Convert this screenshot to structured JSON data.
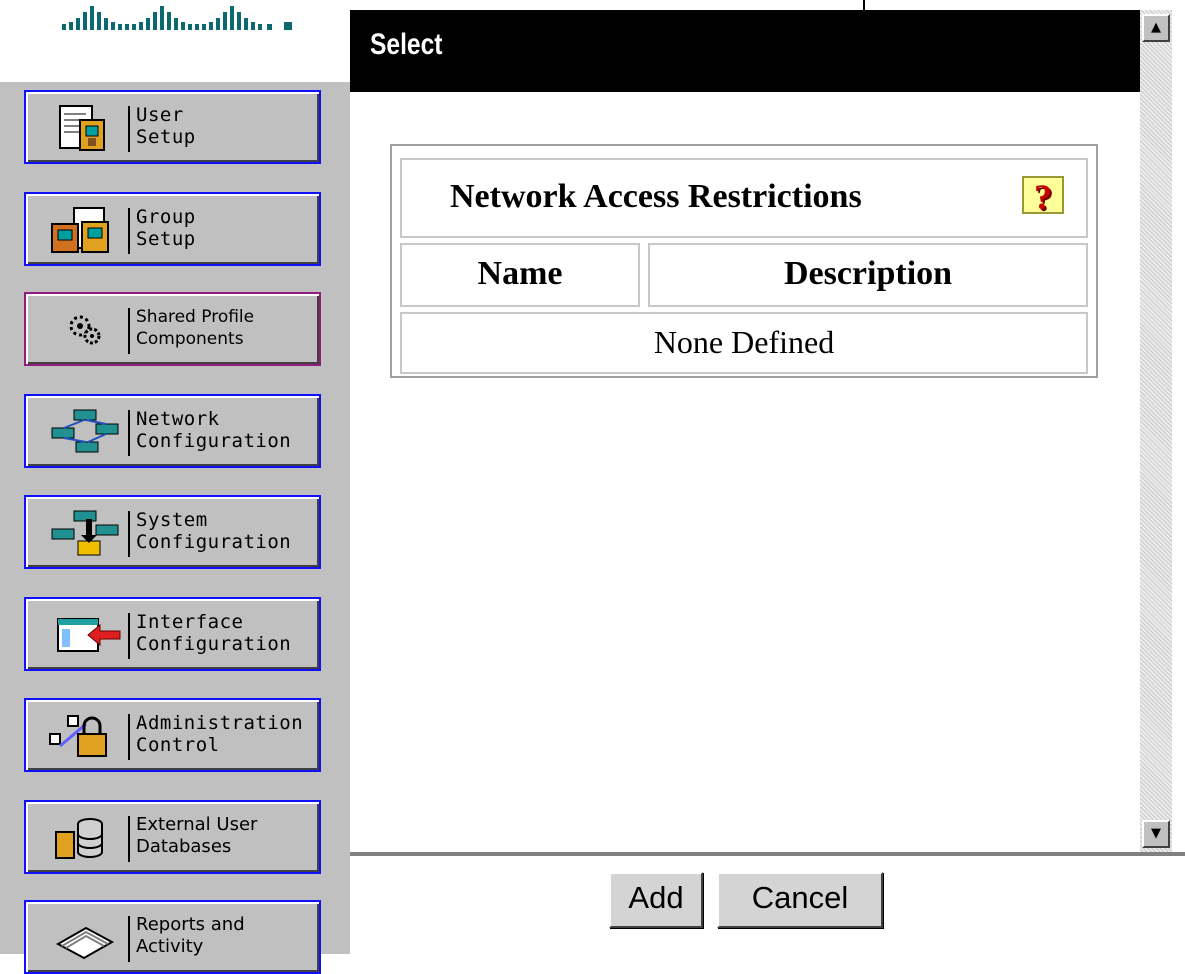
{
  "dialog": {
    "title": "Select"
  },
  "nav": {
    "items": [
      {
        "label": "User\nSetup"
      },
      {
        "label": "Group\nSetup"
      },
      {
        "label": "Shared Profile\nComponents"
      },
      {
        "label": "Network\nConfiguration"
      },
      {
        "label": "System\nConfiguration"
      },
      {
        "label": "Interface\nConfiguration"
      },
      {
        "label": "Administration\nControl"
      },
      {
        "label": "External User\nDatabases"
      },
      {
        "label": "Reports and\nActivity"
      }
    ]
  },
  "table": {
    "caption": "Network Access Restrictions",
    "help_icon": "?",
    "columns": [
      "Name",
      "Description"
    ],
    "empty_text": "None Defined"
  },
  "buttons": {
    "add": "Add",
    "cancel": "Cancel"
  },
  "icons": {
    "help": "question-mark-icon",
    "scroll_up": "▲",
    "scroll_down": "▼"
  },
  "colors": {
    "nav_border": "#1010ff",
    "nav_border_selected": "#901e78",
    "title_bar": "#000000",
    "help_bg": "#ffff99"
  }
}
